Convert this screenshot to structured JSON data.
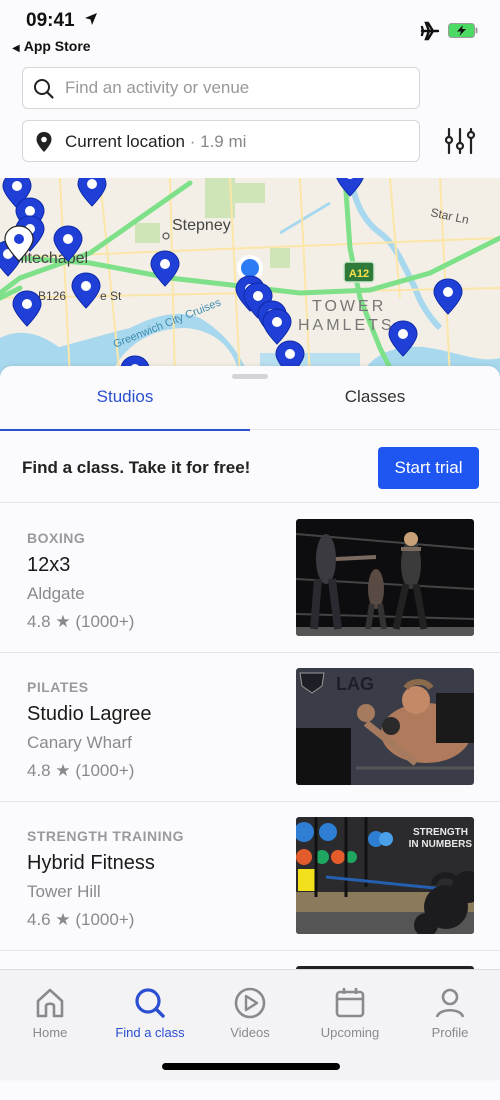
{
  "status_bar": {
    "time": "09:41",
    "back_app": "App Store",
    "icons": [
      "location-arrow-icon",
      "airplane-icon",
      "battery-charging-icon"
    ]
  },
  "search": {
    "placeholder": "Find an activity or venue",
    "value": ""
  },
  "location": {
    "label": "Current location",
    "distance": "· 1.9 mi"
  },
  "map": {
    "labels": [
      "Stepney",
      "Whitechapel",
      "B126",
      "e St",
      "Star Ln",
      "TOWER",
      "HAMLETS",
      "Greenwich City Cruises",
      "A12"
    ],
    "accent": "#1f3fd6",
    "user_location_color": "#2d7cf6"
  },
  "tabs": [
    {
      "label": "Studios",
      "active": true
    },
    {
      "label": "Classes",
      "active": false
    }
  ],
  "promo": {
    "text": "Find a class. Take it for free!",
    "button": "Start trial"
  },
  "studios": [
    {
      "category": "BOXING",
      "name": "12x3",
      "area": "Aldgate",
      "rating": "4.8",
      "reviews": "(1000+)"
    },
    {
      "category": "PILATES",
      "name": "Studio Lagree",
      "area": "Canary Wharf",
      "rating": "4.8",
      "reviews": "(1000+)"
    },
    {
      "category": "STRENGTH TRAINING",
      "name": "Hybrid Fitness",
      "area": "Tower Hill",
      "rating": "4.6",
      "reviews": "(1000+)"
    }
  ],
  "thumb_texts": {
    "lagree": "LAG",
    "strength1": "STRENGTH",
    "strength2": "IN NUMBERS"
  },
  "tabbar": [
    {
      "label": "Home",
      "icon": "home-icon",
      "active": false
    },
    {
      "label": "Find a class",
      "icon": "search-icon",
      "active": true
    },
    {
      "label": "Videos",
      "icon": "play-circle-icon",
      "active": false
    },
    {
      "label": "Upcoming",
      "icon": "calendar-icon",
      "active": false
    },
    {
      "label": "Profile",
      "icon": "profile-icon",
      "active": false
    }
  ],
  "colors": {
    "accent": "#2b4fd0",
    "button": "#1f55f0",
    "road": "#7fe08a",
    "water": "#a8d8ee"
  }
}
